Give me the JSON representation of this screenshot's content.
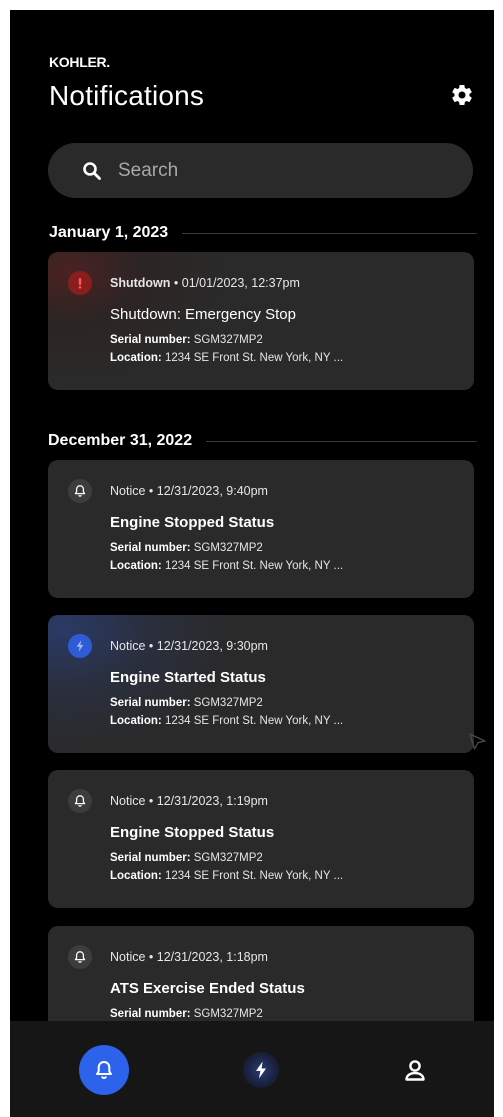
{
  "header": {
    "brand": "KOHLER.",
    "title": "Notifications"
  },
  "search": {
    "placeholder": "Search"
  },
  "groups": [
    {
      "date": "January 1, 2023",
      "items": [
        {
          "type": "Shutdown",
          "timestamp": "• 01/01/2023, 12:37pm",
          "title": "Shutdown: Emergency Stop",
          "serial_label": "Serial number:",
          "serial": "SGM327MP2",
          "location_label": "Location:",
          "location": "1234 SE Front St. New York, NY ...",
          "icon": "alert-icon",
          "icon_color": "#8a1e1e"
        }
      ]
    },
    {
      "date": "December 31, 2022",
      "items": [
        {
          "type": "Notice",
          "timestamp": "• 12/31/2023, 9:40pm",
          "title": "Engine Stopped Status",
          "serial_label": "Serial number:",
          "serial": "SGM327MP2",
          "location_label": "Location:",
          "location": "1234 SE Front St. New York, NY ...",
          "icon": "bell-icon"
        },
        {
          "type": "Notice",
          "timestamp": "• 12/31/2023, 9:30pm",
          "title": "Engine Started Status",
          "serial_label": "Serial number:",
          "serial": "SGM327MP2",
          "location_label": "Location:",
          "location": "1234 SE Front St. New York, NY ...",
          "icon": "bolt-icon",
          "icon_color": "#2f5bd6"
        },
        {
          "type": "Notice",
          "timestamp": "• 12/31/2023, 1:19pm",
          "title": "Engine Stopped Status",
          "serial_label": "Serial number:",
          "serial": "SGM327MP2",
          "location_label": "Location:",
          "location": "1234 SE Front St. New York, NY ...",
          "icon": "bell-icon"
        },
        {
          "type": "Notice",
          "timestamp": "• 12/31/2023, 1:18pm",
          "title": "ATS Exercise Ended Status",
          "serial_label": "Serial number:",
          "serial": "SGM327MP2",
          "icon": "bell-icon"
        }
      ]
    }
  ],
  "bottom_nav": {
    "items": [
      {
        "icon": "bell-icon",
        "active": true
      },
      {
        "icon": "bolt-icon",
        "active": false
      },
      {
        "icon": "profile-icon",
        "active": false
      }
    ]
  },
  "colors": {
    "background": "#000000",
    "card": "#2a2a2a",
    "accent": "#2d63ea",
    "alert": "#8a1e1e"
  }
}
